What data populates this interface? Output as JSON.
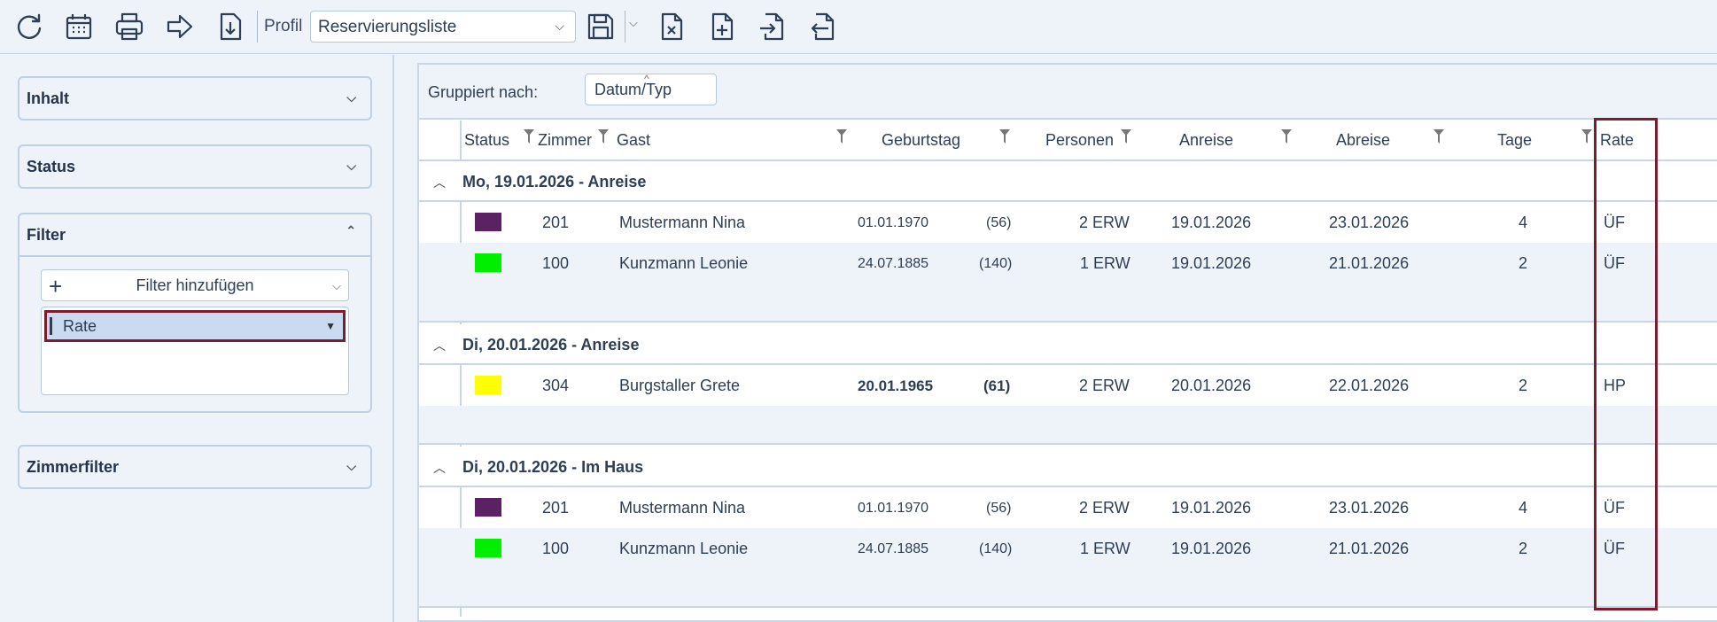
{
  "toolbar": {
    "icons": [
      "refresh-icon",
      "calendar-icon",
      "print-icon",
      "forward-arrow-icon",
      "download-icon"
    ],
    "profil_label": "Profil",
    "profil_value": "Reservierungsliste",
    "right_icons": [
      "save-icon",
      "file-delete-icon",
      "file-add-icon",
      "file-import-icon",
      "file-export-icon"
    ]
  },
  "sidebar": {
    "inhalt": "Inhalt",
    "status": "Status",
    "filter": "Filter",
    "filter_add": "Filter hinzufügen",
    "filter_item": "Rate",
    "zimmerfilter": "Zimmerfilter"
  },
  "grouping": {
    "label": "Gruppiert nach:",
    "value": "Datum/Typ"
  },
  "columns": {
    "status": "Status",
    "zimmer": "Zimmer",
    "gast": "Gast",
    "geburtstag": "Geburtstag",
    "personen": "Personen",
    "anreise": "Anreise",
    "abreise": "Abreise",
    "tage": "Tage",
    "rate": "Rate"
  },
  "groups": [
    {
      "title": "Mo, 19.01.2026 - Anreise",
      "rows": [
        {
          "color": "#5a2163",
          "zimmer": "201",
          "gast": "Mustermann Nina",
          "geburtstag": "01.01.1970",
          "alter": "(56)",
          "personen": "2 ERW",
          "anreise": "19.01.2026",
          "abreise": "23.01.2026",
          "tage": "4",
          "rate": "ÜF"
        },
        {
          "color": "#00ee00",
          "zimmer": "100",
          "gast": "Kunzmann Leonie",
          "geburtstag": "24.07.1885",
          "alter": "(140)",
          "personen": "1 ERW",
          "anreise": "19.01.2026",
          "abreise": "21.01.2026",
          "tage": "2",
          "rate": "ÜF"
        }
      ]
    },
    {
      "title": "Di, 20.01.2026 - Anreise",
      "rows": [
        {
          "color": "#ffff00",
          "zimmer": "304",
          "gast": "Burgstaller Grete",
          "geburtstag": "20.01.1965",
          "alter": "(61)",
          "personen": "2 ERW",
          "anreise": "20.01.2026",
          "abreise": "22.01.2026",
          "tage": "2",
          "rate": "HP"
        }
      ]
    },
    {
      "title": "Di, 20.01.2026 - Im Haus",
      "rows": [
        {
          "color": "#5a2163",
          "zimmer": "201",
          "gast": "Mustermann Nina",
          "geburtstag": "01.01.1970",
          "alter": "(56)",
          "personen": "2 ERW",
          "anreise": "19.01.2026",
          "abreise": "23.01.2026",
          "tage": "4",
          "rate": "ÜF"
        },
        {
          "color": "#00ee00",
          "zimmer": "100",
          "gast": "Kunzmann Leonie",
          "geburtstag": "24.07.1885",
          "alter": "(140)",
          "personen": "1 ERW",
          "anreise": "19.01.2026",
          "abreise": "21.01.2026",
          "tage": "2",
          "rate": "ÜF"
        }
      ]
    }
  ]
}
